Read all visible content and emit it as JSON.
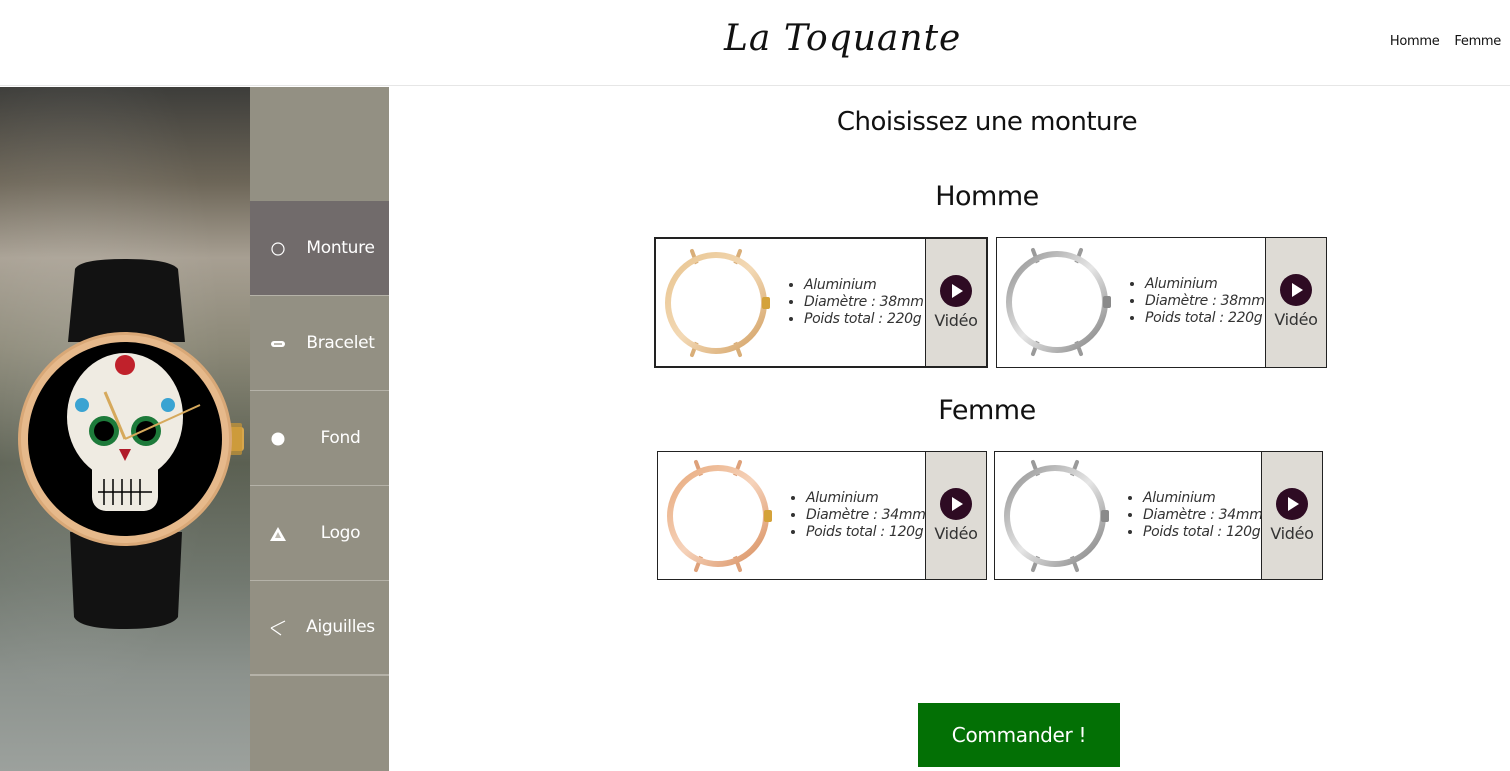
{
  "header": {
    "brand": "La Toquante",
    "nav": [
      {
        "label": "Homme"
      },
      {
        "label": "Femme"
      }
    ]
  },
  "sidebar": {
    "items": [
      {
        "label": "Monture",
        "icon": "ring-icon",
        "active": true
      },
      {
        "label": "Bracelet",
        "icon": "strap-icon",
        "active": false
      },
      {
        "label": "Fond",
        "icon": "dial-icon",
        "active": false
      },
      {
        "label": "Logo",
        "icon": "logo-icon",
        "active": false
      },
      {
        "label": "Aiguilles",
        "icon": "hands-icon",
        "active": false
      }
    ]
  },
  "main": {
    "title": "Choisissez une monture",
    "sections": [
      {
        "title": "Homme",
        "cards": [
          {
            "material": "Aluminium",
            "diameter": "Diamètre : 38mm",
            "weight": "Poids total : 220g",
            "video": "Vidéo",
            "finish": "gold",
            "selected": true
          },
          {
            "material": "Aluminium",
            "diameter": "Diamètre : 38mm",
            "weight": "Poids total : 220g",
            "video": "Vidéo",
            "finish": "silver",
            "selected": false
          }
        ]
      },
      {
        "title": "Femme",
        "cards": [
          {
            "material": "Aluminium",
            "diameter": "Diamètre : 34mm",
            "weight": "Poids total : 120g",
            "video": "Vidéo",
            "finish": "rose-gold",
            "selected": false
          },
          {
            "material": "Aluminium",
            "diameter": "Diamètre : 34mm",
            "weight": "Poids total : 120g",
            "video": "Vidéo",
            "finish": "silver",
            "selected": false
          }
        ]
      }
    ],
    "order_label": "Commander !"
  },
  "colors": {
    "sidebar_bg": "#939083",
    "sidebar_active": "#716b6b",
    "order_button": "#037005",
    "play_icon": "#2e0b23",
    "video_panel": "#dedbd5"
  }
}
